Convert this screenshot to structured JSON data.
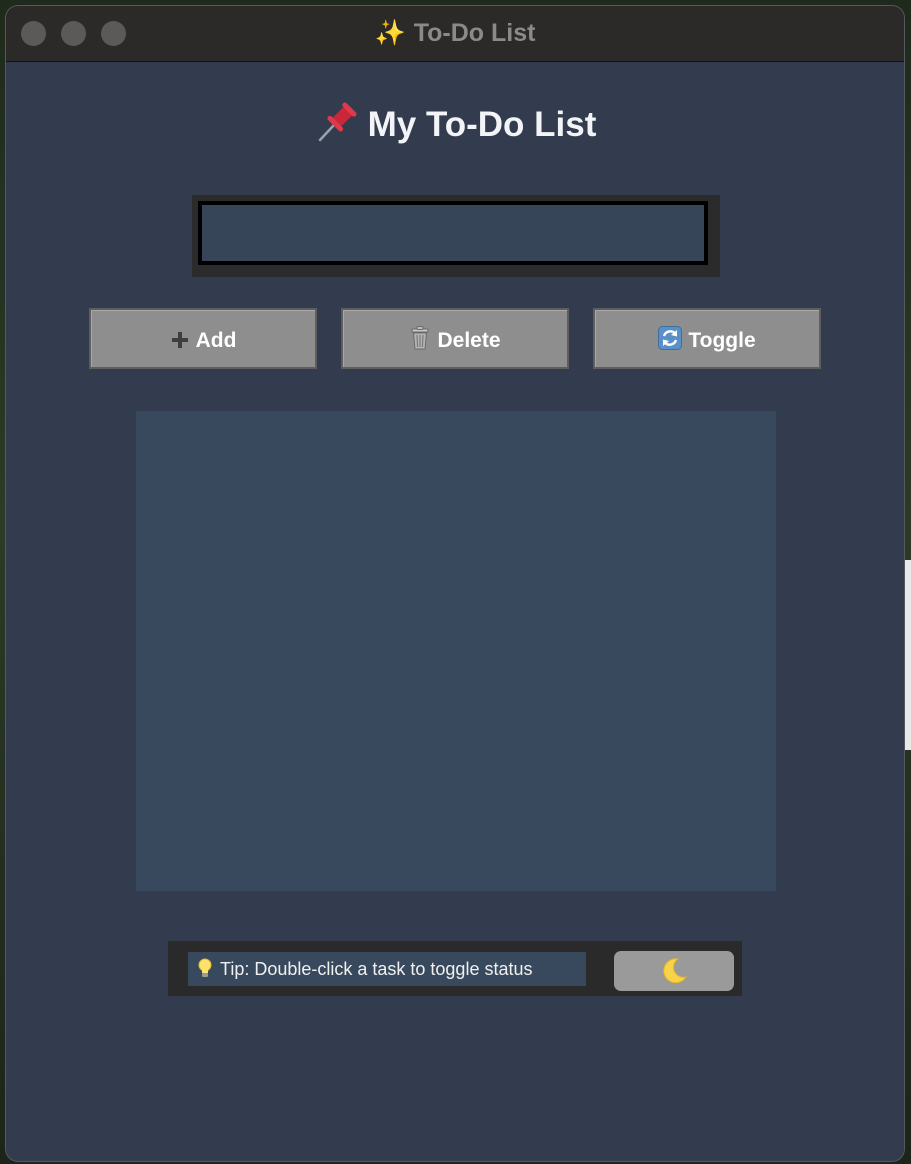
{
  "window": {
    "title_icon": "sparkles-icon",
    "title": "To-Do List"
  },
  "heading": {
    "icon": "pushpin-icon",
    "text": "My To-Do List"
  },
  "task_input": {
    "value": "",
    "placeholder": ""
  },
  "buttons": {
    "add": {
      "icon": "plus-icon",
      "label": "Add"
    },
    "delete": {
      "icon": "trash-icon",
      "label": "Delete"
    },
    "toggle": {
      "icon": "refresh-icon",
      "label": "Toggle"
    }
  },
  "task_list": {
    "items": []
  },
  "tip": {
    "icon": "lightbulb-icon",
    "text": "Tip: Double-click a task to toggle status"
  },
  "theme_toggle": {
    "icon": "moon-icon"
  },
  "colors": {
    "window_bg": "#323c4e",
    "input_bg": "#364558",
    "list_bg": "#38495d",
    "button_bg": "#8e8e8e",
    "heading_text": "#f2f4f7"
  }
}
